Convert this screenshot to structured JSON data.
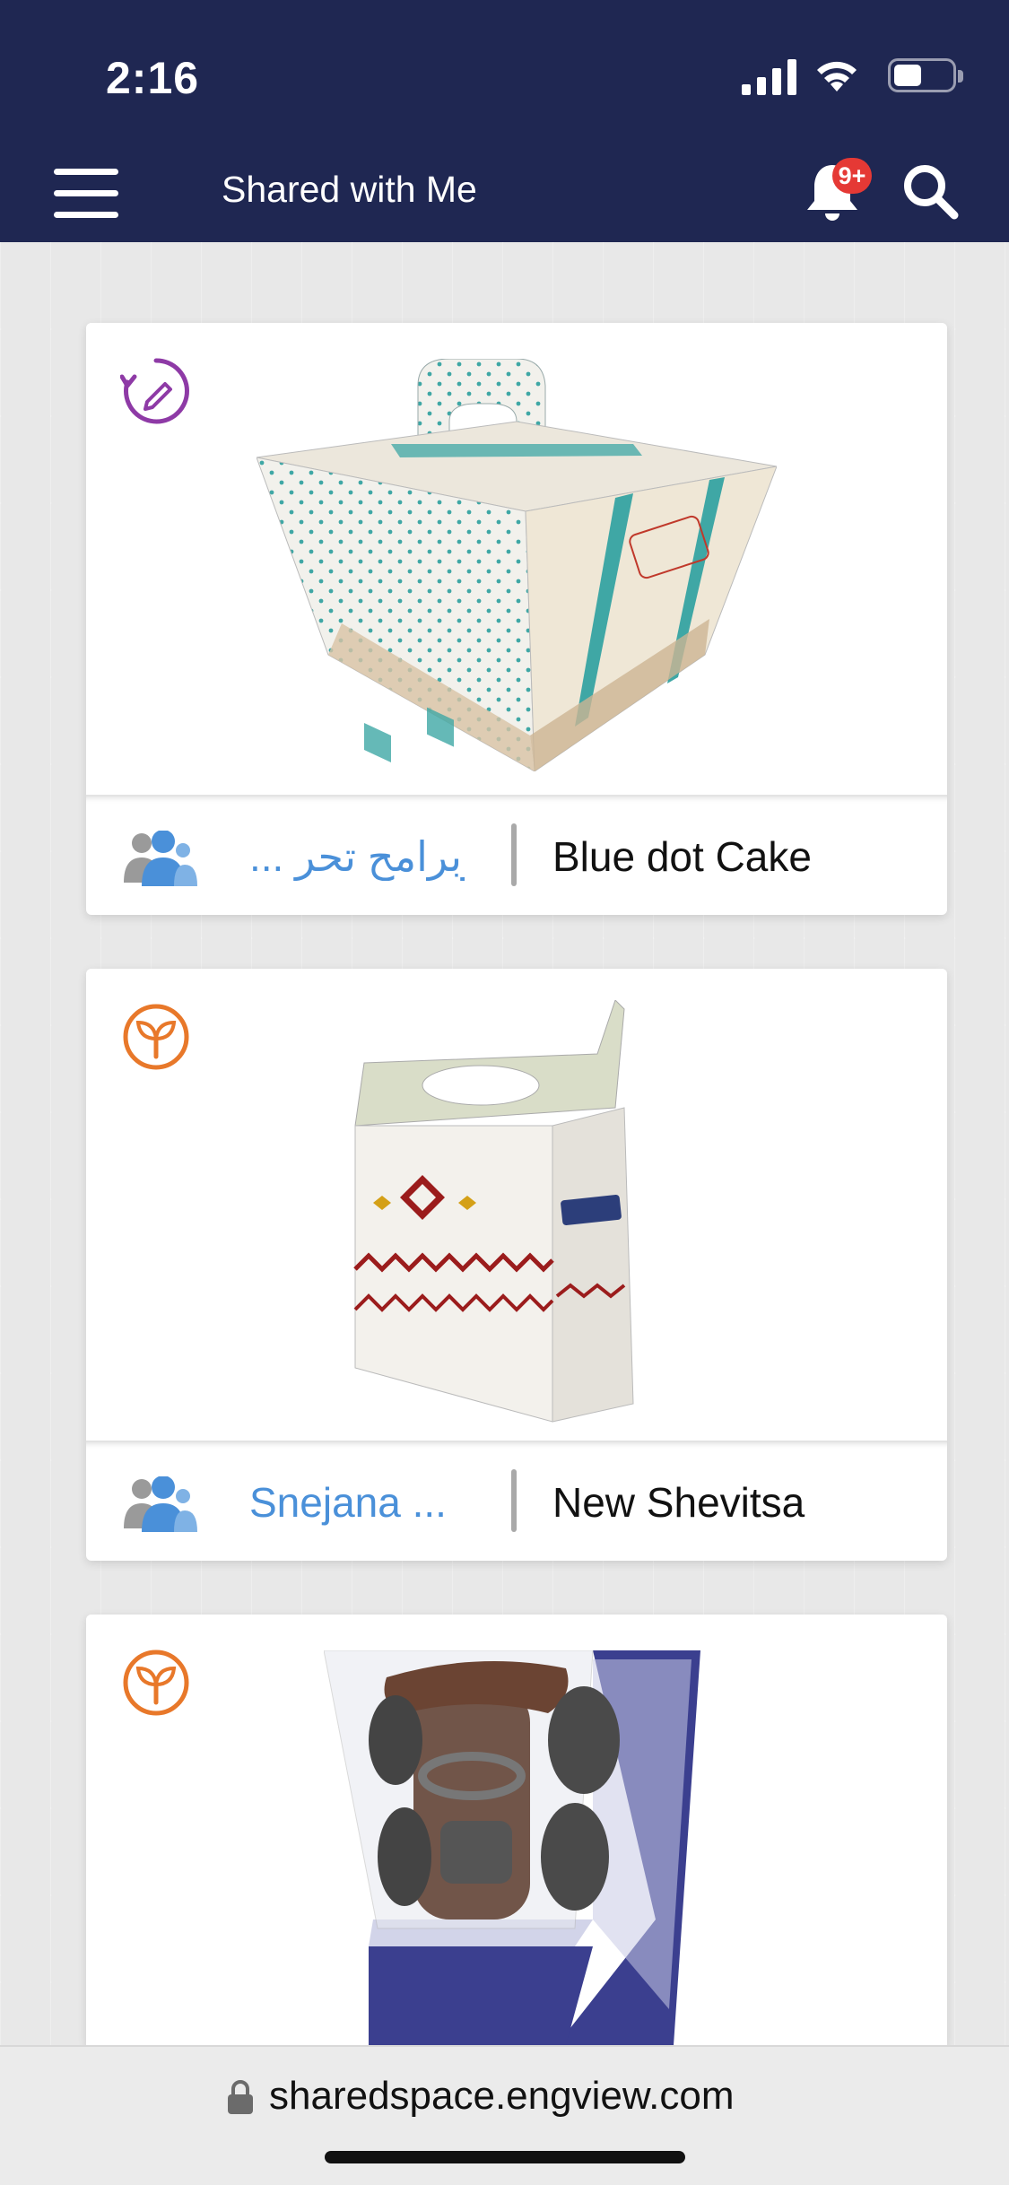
{
  "status_bar": {
    "time": "2:16"
  },
  "header": {
    "title": "Shared with Me",
    "notification_badge": "9+"
  },
  "cards": [
    {
      "status_icon": "edit-revision-icon",
      "status_color": "#8e3aa6",
      "owner": "... وبرامح تحر",
      "name": "Blue dot Cake"
    },
    {
      "status_icon": "sprout-icon",
      "status_color": "#e8782a",
      "owner": "Snejana ...",
      "name": "New Shevitsa"
    },
    {
      "status_icon": "sprout-icon",
      "status_color": "#e8782a",
      "owner": "",
      "name": ""
    }
  ],
  "browser": {
    "url": "sharedspace.engview.com"
  },
  "colors": {
    "header_bg": "#1f2752",
    "owner_link": "#4a90d9",
    "badge": "#e53935"
  }
}
